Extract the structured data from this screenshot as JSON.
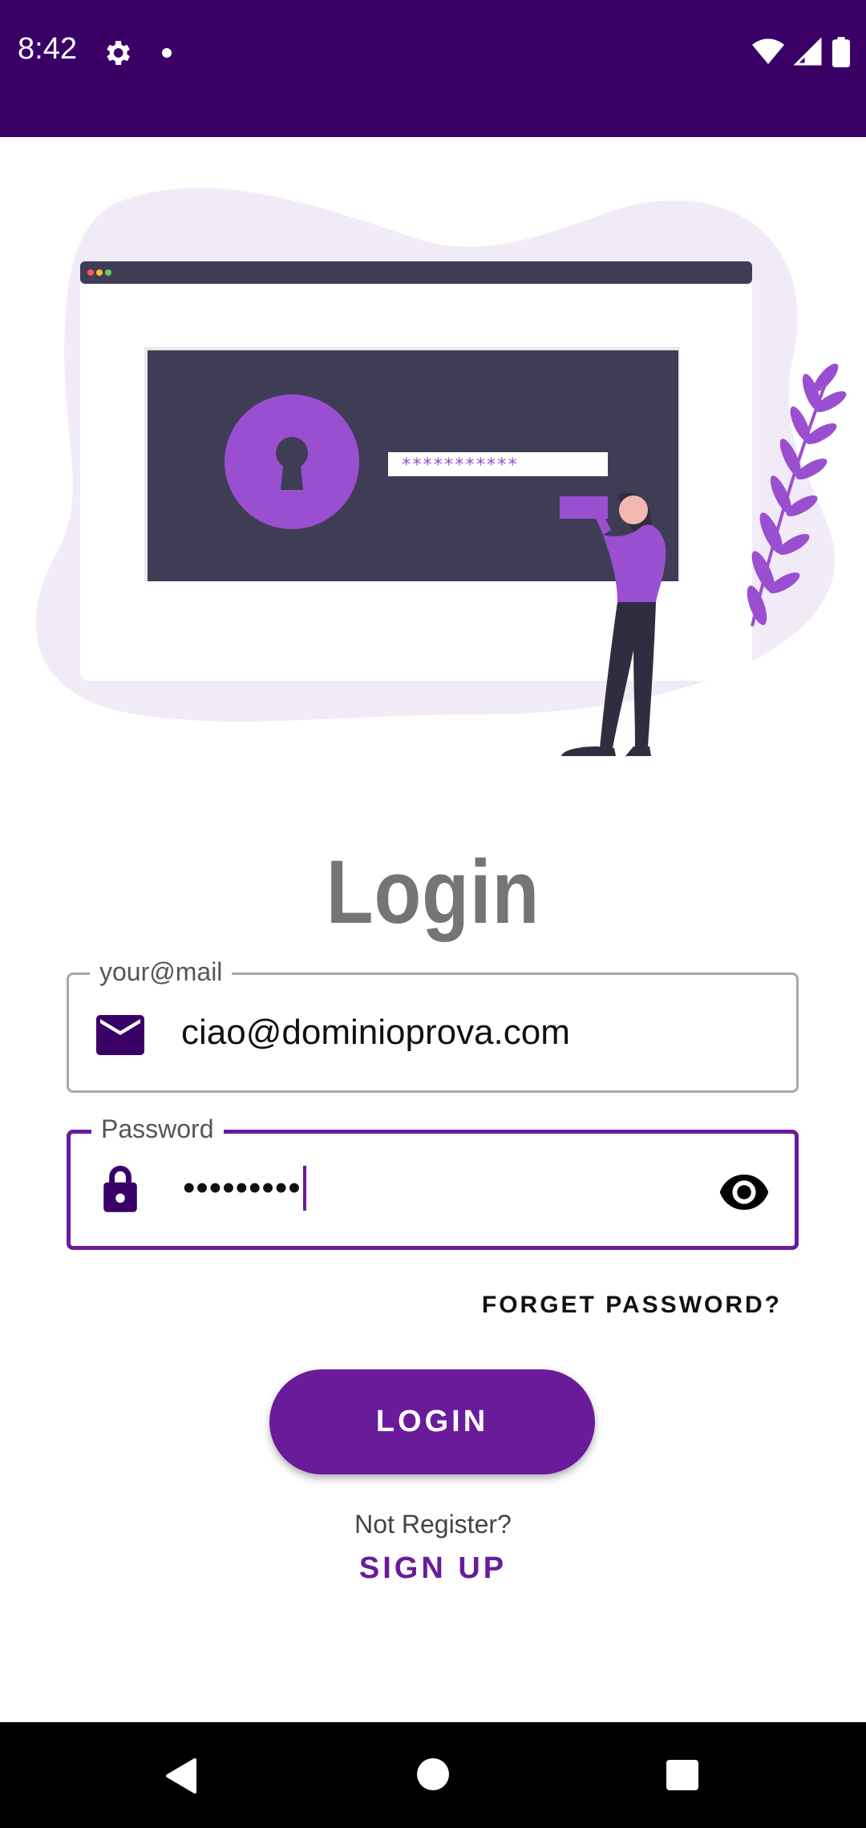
{
  "status_bar": {
    "time": "8:42",
    "icons": [
      "gear-icon",
      "notification-dot-icon",
      "wifi-icon",
      "cell-signal-icon",
      "battery-icon"
    ]
  },
  "illustration": {
    "description_icon": "login-illustration",
    "password_mask": "***********"
  },
  "title": "Login",
  "email_field": {
    "label": "your@mail",
    "value": "ciao@dominioprova.com",
    "icon": "mail-icon"
  },
  "password_field": {
    "label": "Password",
    "value": "•••••••••",
    "icon": "lock-icon",
    "toggle_icon": "eye-icon"
  },
  "forget_password": "FORGET PASSWORD?",
  "login_button": "LOGIN",
  "not_register": "Not Register?",
  "sign_up": "SIGN UP",
  "nav_bar": {
    "icons": [
      "back-icon",
      "home-icon",
      "recents-icon"
    ]
  },
  "colors": {
    "status_bar": "#3a0066",
    "primary": "#6a1b9a",
    "title_gray": "#757575",
    "blob": "#f1ebf8"
  }
}
